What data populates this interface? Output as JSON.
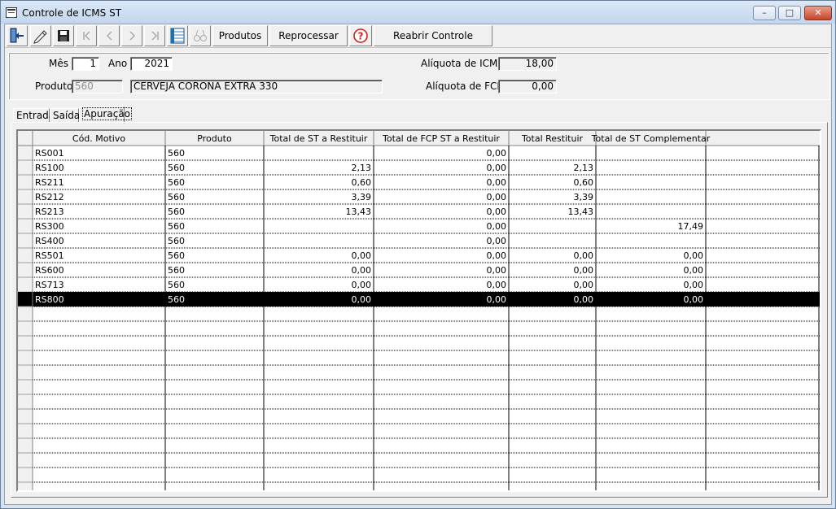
{
  "window": {
    "title": "Controle de ICMS ST",
    "controls": {
      "minimize": "–",
      "maximize": "□",
      "close": "✕"
    }
  },
  "toolbar": {
    "buttons": [
      {
        "name": "exit-button",
        "icon": "exit-door-icon"
      },
      {
        "name": "edit-button",
        "icon": "pencil-icon"
      },
      {
        "name": "save-button",
        "icon": "floppy-disk-icon"
      },
      {
        "name": "first-record-button",
        "icon": "first-record-icon",
        "disabled": true
      },
      {
        "name": "previous-record-button",
        "icon": "previous-record-icon",
        "disabled": true
      },
      {
        "name": "next-record-button",
        "icon": "next-record-icon",
        "disabled": true
      },
      {
        "name": "last-record-button",
        "icon": "last-record-icon",
        "disabled": true
      },
      {
        "name": "grid-view-button",
        "icon": "grid-icon"
      },
      {
        "name": "search-button",
        "icon": "binoculars-icon",
        "disabled": true
      }
    ],
    "produtos_label": "Produtos",
    "reprocessar_label": "Reprocessar",
    "help_icon": "help-icon",
    "reabrir_label": "Reabrir Controle"
  },
  "form": {
    "mes_label": "Mês",
    "mes_value": "1",
    "ano_label": "Ano",
    "ano_value": "2021",
    "produto_label": "Produto",
    "produto_code": "560",
    "produto_desc": "CERVEJA CORONA EXTRA 330",
    "aliq_icms_label": "Alíquota de ICMS",
    "aliq_icms_value": "18,00",
    "aliq_fcp_label": "Alíquota de FCP",
    "aliq_fcp_value": "0,00"
  },
  "tabs": [
    {
      "label": "Entrada",
      "selected": false
    },
    {
      "label": "Saída",
      "selected": false
    },
    {
      "label": "Apuração",
      "selected": true
    }
  ],
  "grid": {
    "columns": [
      "Cód. Motivo",
      "Produto",
      "Total de ST a Restituir",
      "Total de FCP ST a Restituir",
      "Total Restituir",
      "Total de ST Complementar"
    ],
    "rows": [
      [
        "RS001",
        "560",
        "",
        "0,00",
        "",
        ""
      ],
      [
        "RS100",
        "560",
        "2,13",
        "0,00",
        "2,13",
        ""
      ],
      [
        "RS211",
        "560",
        "0,60",
        "0,00",
        "0,60",
        ""
      ],
      [
        "RS212",
        "560",
        "3,39",
        "0,00",
        "3,39",
        ""
      ],
      [
        "RS213",
        "560",
        "13,43",
        "0,00",
        "13,43",
        ""
      ],
      [
        "RS300",
        "560",
        "",
        "0,00",
        "",
        "17,49"
      ],
      [
        "RS400",
        "560",
        "",
        "0,00",
        "",
        ""
      ],
      [
        "RS501",
        "560",
        "0,00",
        "0,00",
        "0,00",
        "0,00"
      ],
      [
        "RS600",
        "560",
        "0,00",
        "0,00",
        "0,00",
        "0,00"
      ],
      [
        "RS713",
        "560",
        "0,00",
        "0,00",
        "0,00",
        "0,00"
      ],
      [
        "RS800",
        "560",
        "0,00",
        "0,00",
        "0,00",
        "0,00"
      ]
    ],
    "selected_row": 10,
    "empty_rows": 13,
    "colors": {
      "selected_bg": "#000000",
      "selected_fg": "#ffffff",
      "grid_line": "#000000"
    }
  }
}
